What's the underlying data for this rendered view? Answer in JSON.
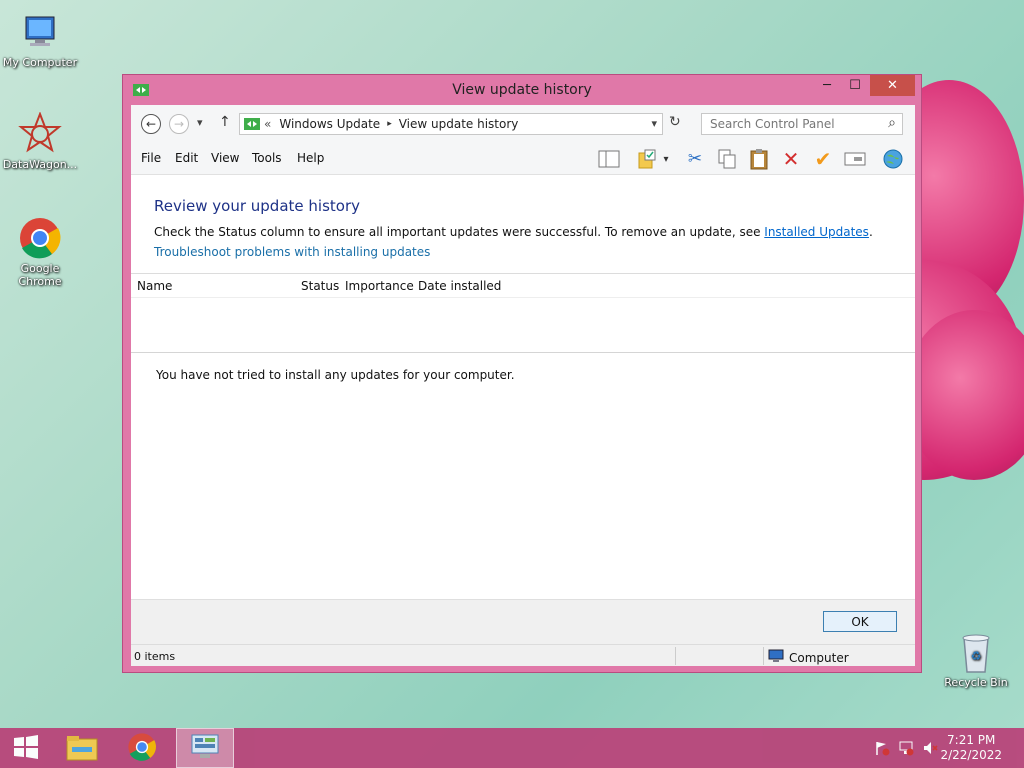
{
  "desktop": {
    "icons": [
      {
        "label": "My Computer",
        "icon": "computer-icon"
      },
      {
        "label": "DataWagon...",
        "icon": "datawagon-icon"
      },
      {
        "label": "Google Chrome",
        "icon": "chrome-icon"
      },
      {
        "label": "Recycle Bin",
        "icon": "recycle-bin-icon"
      }
    ]
  },
  "window": {
    "title": "View update history",
    "controls": {
      "minimize": "─",
      "maximize": "☐",
      "close": "✕"
    }
  },
  "address_bar": {
    "back": "←",
    "forward": "→",
    "dropdown": "▾",
    "up": "↑",
    "overflow": "«",
    "crumbs": [
      "Windows Update",
      "View update history"
    ],
    "separator": "▸",
    "refresh": "↻",
    "search_placeholder": "Search Control Panel",
    "search_icon": "⌕"
  },
  "menu": {
    "items": [
      "File",
      "Edit",
      "View",
      "Tools",
      "Help"
    ]
  },
  "content": {
    "heading": "Review your update history",
    "description_prefix": "Check the Status column to ensure all important updates were successful. To remove an update, see ",
    "installed_updates_link": "Installed Updates",
    "description_suffix": ".",
    "troubleshoot_link": "Troubleshoot problems with installing updates",
    "columns": [
      "Name",
      "Status",
      "Importance",
      "Date installed"
    ],
    "empty_message": "You have not tried to install any updates for your computer."
  },
  "footer": {
    "ok_label": "OK"
  },
  "status_bar": {
    "item_count": "0 items",
    "location": "Computer"
  },
  "taskbar": {
    "time": "7:21 PM",
    "date": "2/22/2022"
  },
  "colors": {
    "window_frame": "#e078a8",
    "taskbar": "#b8457a",
    "heading": "#1e3287",
    "link": "#1a6fa8"
  }
}
